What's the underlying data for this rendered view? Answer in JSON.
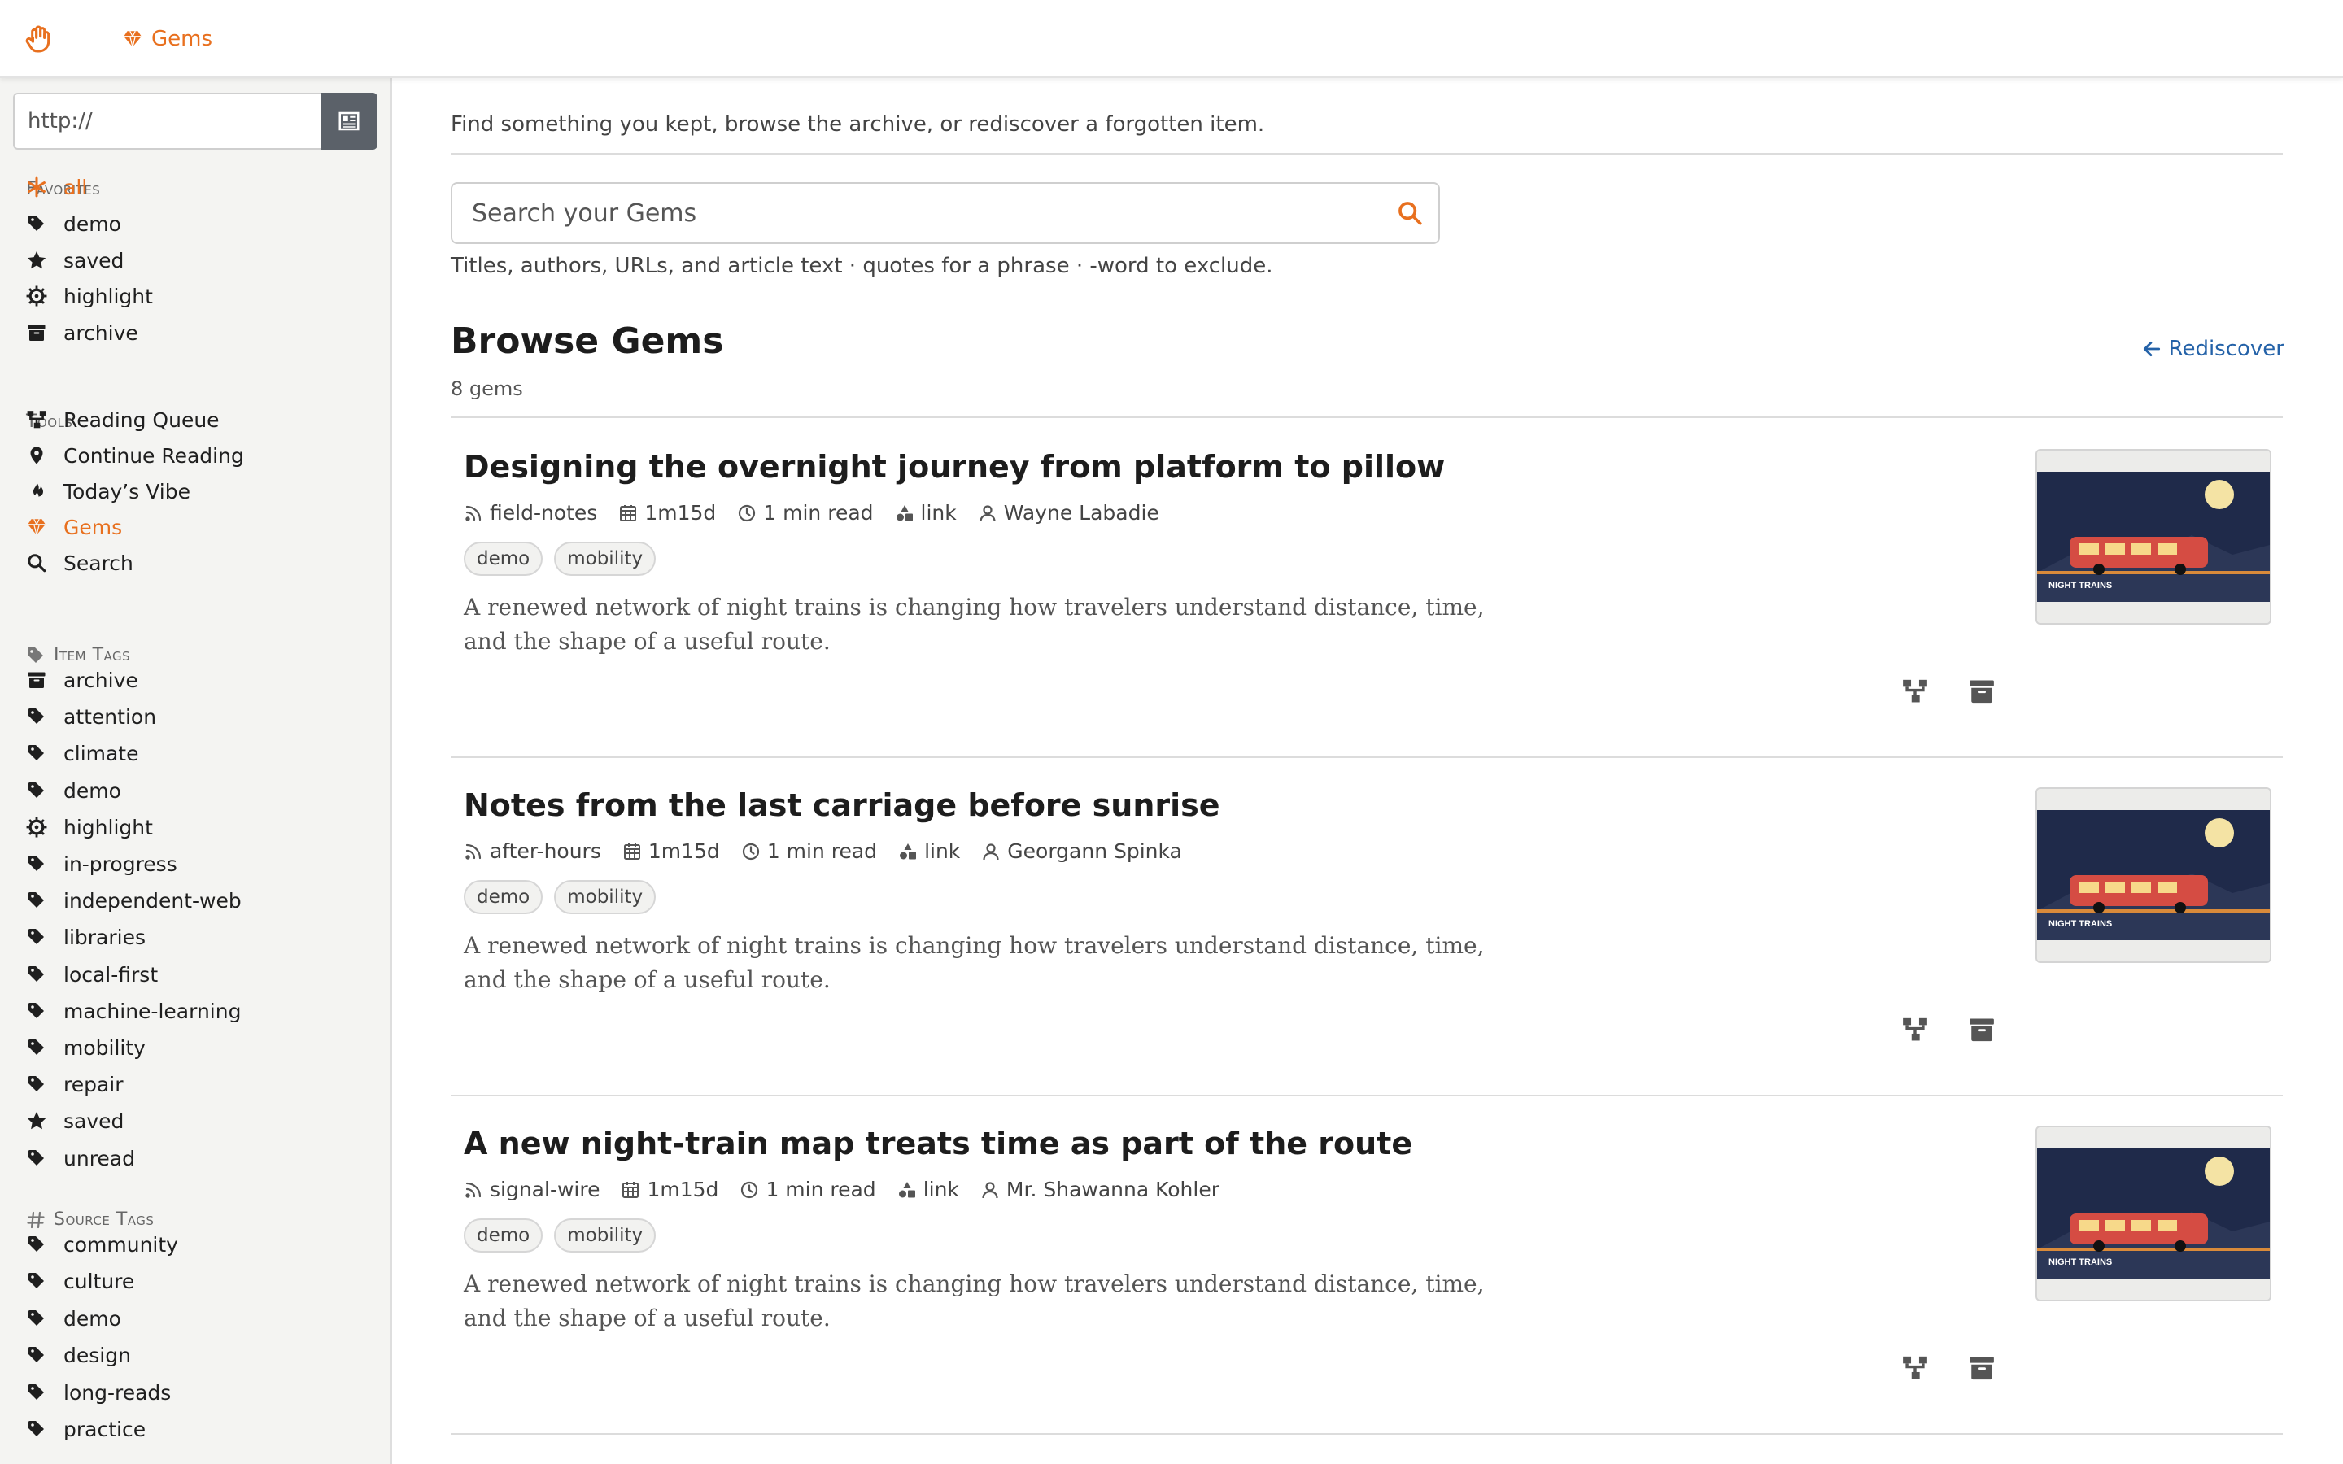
{
  "topbar": {
    "gems_label": "Gems",
    "accent": "#e8701f"
  },
  "sidebar": {
    "url_placeholder": "http://",
    "favorites": {
      "heading": "Favorites",
      "items": [
        {
          "label": "all",
          "icon": "asterisk-icon",
          "active": true
        },
        {
          "label": "demo",
          "icon": "tag-icon"
        },
        {
          "label": "saved",
          "icon": "star-icon"
        },
        {
          "label": "highlight",
          "icon": "sun-icon"
        },
        {
          "label": "archive",
          "icon": "archive-icon"
        }
      ]
    },
    "tools": {
      "heading": "Tools",
      "items": [
        {
          "label": "Reading Queue",
          "icon": "queue-icon"
        },
        {
          "label": "Continue Reading",
          "icon": "location-pin-icon"
        },
        {
          "label": "Today’s Vibe",
          "icon": "flame-icon"
        },
        {
          "label": "Gems",
          "icon": "gem-icon",
          "active": true
        },
        {
          "label": "Search",
          "icon": "search-icon"
        }
      ]
    },
    "item_tags": {
      "heading": "Item Tags",
      "items": [
        {
          "label": "archive",
          "icon": "archive-icon"
        },
        {
          "label": "attention",
          "icon": "tag-icon"
        },
        {
          "label": "climate",
          "icon": "tag-icon"
        },
        {
          "label": "demo",
          "icon": "tag-icon"
        },
        {
          "label": "highlight",
          "icon": "sun-icon"
        },
        {
          "label": "in-progress",
          "icon": "tag-icon"
        },
        {
          "label": "independent-web",
          "icon": "tag-icon"
        },
        {
          "label": "libraries",
          "icon": "tag-icon"
        },
        {
          "label": "local-first",
          "icon": "tag-icon"
        },
        {
          "label": "machine-learning",
          "icon": "tag-icon"
        },
        {
          "label": "mobility",
          "icon": "tag-icon"
        },
        {
          "label": "repair",
          "icon": "tag-icon"
        },
        {
          "label": "saved",
          "icon": "star-icon"
        },
        {
          "label": "unread",
          "icon": "tag-icon"
        }
      ]
    },
    "source_tags": {
      "heading": "Source Tags",
      "items": [
        {
          "label": "community",
          "icon": "tag-icon"
        },
        {
          "label": "culture",
          "icon": "tag-icon"
        },
        {
          "label": "demo",
          "icon": "tag-icon"
        },
        {
          "label": "design",
          "icon": "tag-icon"
        },
        {
          "label": "long-reads",
          "icon": "tag-icon"
        },
        {
          "label": "practice",
          "icon": "tag-icon"
        }
      ]
    }
  },
  "main": {
    "intro": "Find something you kept, browse the archive, or rediscover a forgotten item.",
    "search_placeholder": "Search your Gems",
    "search_hint": "Titles, authors, URLs, and article text · quotes for a phrase · -word to exclude.",
    "heading": "Browse Gems",
    "count": "8 gems",
    "rediscover_label": "Rediscover",
    "link_color": "#2462a8",
    "cards": [
      {
        "title": "Designing the overnight journey from platform to pillow",
        "source": "field-notes",
        "age": "1m15d",
        "read_time": "1 min read",
        "kind": "link",
        "author": "Wayne Labadie",
        "tags": [
          "demo",
          "mobility"
        ],
        "excerpt": "A renewed network of night trains is changing how travelers understand distance, time, and the shape of a useful route.",
        "thumb_caption": "NIGHT TRAINS"
      },
      {
        "title": "Notes from the last carriage before sunrise",
        "source": "after-hours",
        "age": "1m15d",
        "read_time": "1 min read",
        "kind": "link",
        "author": "Georgann Spinka",
        "tags": [
          "demo",
          "mobility"
        ],
        "excerpt": "A renewed network of night trains is changing how travelers understand distance, time, and the shape of a useful route.",
        "thumb_caption": "NIGHT TRAINS"
      },
      {
        "title": "A new night-train map treats time as part of the route",
        "source": "signal-wire",
        "age": "1m15d",
        "read_time": "1 min read",
        "kind": "link",
        "author": "Mr. Shawanna Kohler",
        "tags": [
          "demo",
          "mobility"
        ],
        "excerpt": "A renewed network of night trains is changing how travelers understand distance, time, and the shape of a useful route.",
        "thumb_caption": "NIGHT TRAINS"
      }
    ]
  }
}
